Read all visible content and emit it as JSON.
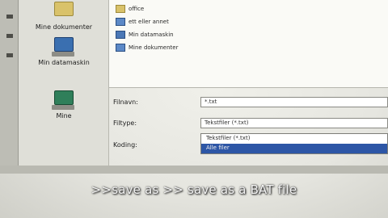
{
  "places": [
    {
      "label": "Mine dokumenter"
    },
    {
      "label": "Min datamaskin"
    },
    {
      "label": "Mine"
    }
  ],
  "files": [
    {
      "name": "office",
      "icon": "folder-icon"
    },
    {
      "name": "ett eller annet",
      "icon": "document-icon"
    },
    {
      "name": "Min datamaskin",
      "icon": "computer-icon"
    },
    {
      "name": "Mine dokumenter",
      "icon": "document-icon"
    }
  ],
  "form": {
    "filename_label": "Filnavn:",
    "filename_value": "*.txt",
    "filetype_label": "Filtype:",
    "filetype_value": "Tekstfiler (*.txt)",
    "encoding_label": "Koding:",
    "dropdown_options": [
      "Tekstfiler (*.txt)",
      "Alle filer"
    ]
  },
  "caption": ">>save as >> save as a BAT file"
}
